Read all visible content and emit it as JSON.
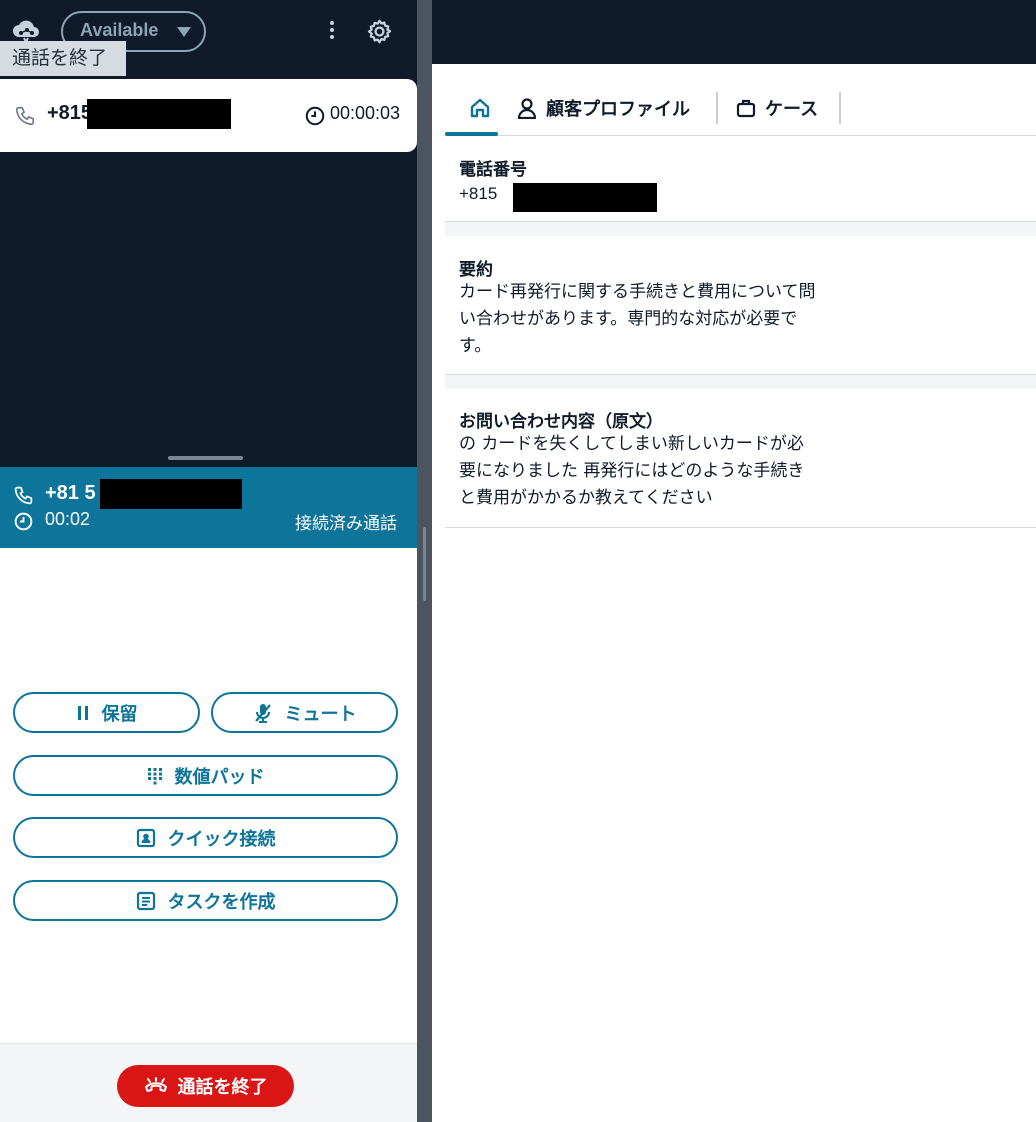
{
  "ccp": {
    "status": "Available",
    "tooltip": "通話を終了",
    "incoming_call": {
      "number": "+815",
      "timer": "00:00:03"
    },
    "connected": {
      "number": "+81 5",
      "duration": "00:02",
      "state": "接続済み通話"
    },
    "buttons": {
      "hold": "保留",
      "mute": "ミュート",
      "keypad": "数値パッド",
      "quick_connect": "クイック接続",
      "create_task": "タスクを作成"
    },
    "end_call": "通話を終了"
  },
  "workspace": {
    "tabs": {
      "profile": "顧客プロファイル",
      "case": "ケース"
    },
    "phone": {
      "title": "電話番号",
      "value": "+815"
    },
    "summary": {
      "title": "要約",
      "lines": [
        "カード再発行に関する手続きと費用について問",
        "い合わせがあります。専門的な対応が必要で",
        "す。"
      ]
    },
    "inquiry": {
      "title": "お問い合わせ内容（原文）",
      "lines": [
        "の カードを失くしてしまい新しいカードが必",
        "要になりました 再発行にはどのような手続き",
        "と費用がかかるか教えてください"
      ]
    }
  },
  "colors": {
    "navy": "#0f1b2a",
    "teal": "#0d749a",
    "end_red": "#d91515",
    "status_gray": "#8da3b8"
  },
  "icons": [
    "cloud-logo-icon",
    "caret-down-icon",
    "kebab-menu-icon",
    "gear-icon",
    "phone-icon",
    "clock-icon",
    "pause-icon",
    "mic-off-icon",
    "keypad-icon",
    "contact-card-icon",
    "task-list-icon",
    "hang-up-icon",
    "home-icon",
    "user-icon",
    "briefcase-icon"
  ]
}
